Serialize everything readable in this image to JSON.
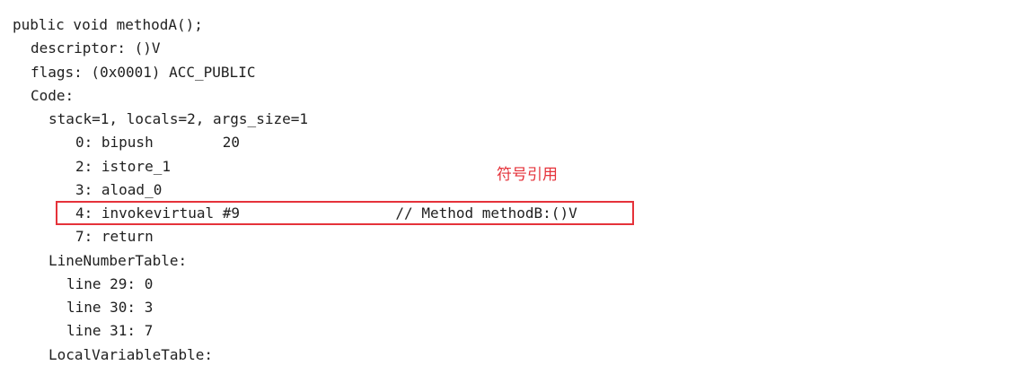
{
  "method": {
    "signature": "public void methodA();",
    "descriptor": "descriptor: ()V",
    "flags": "flags: (0x0001) ACC_PUBLIC",
    "code_header": "Code:",
    "stack_info": "stack=1, locals=2, args_size=1"
  },
  "instructions": [
    {
      "text": "0: bipush        20"
    },
    {
      "text": "2: istore_1"
    },
    {
      "text": "3: aload_0"
    },
    {
      "text": "4: invokevirtual #9                  // Method methodB:()V"
    },
    {
      "text": "7: return"
    }
  ],
  "line_number_table": {
    "header": "LineNumberTable:",
    "entries": [
      {
        "text": "line 29: 0"
      },
      {
        "text": "line 30: 3"
      },
      {
        "text": "line 31: 7"
      }
    ]
  },
  "local_variable_table": {
    "header": "LocalVariableTable:"
  },
  "annotation": {
    "label": "符号引用",
    "color": "#e5323a"
  }
}
